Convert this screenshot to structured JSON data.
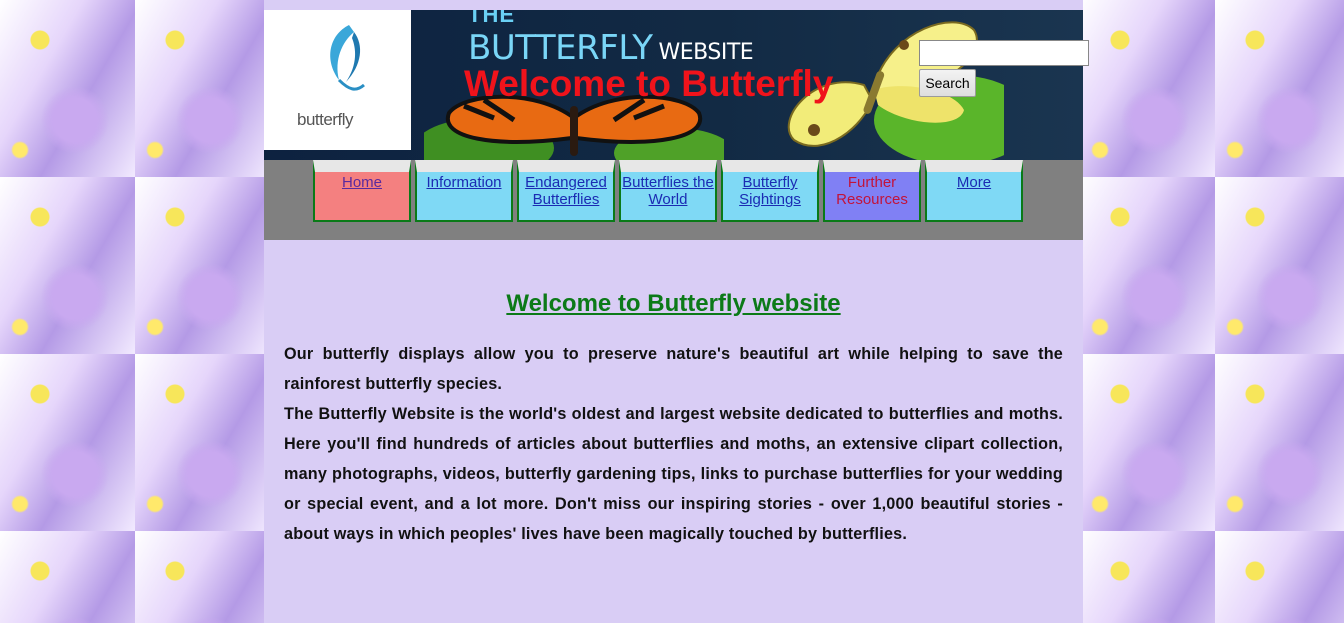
{
  "banner": {
    "logo_text": "butterfly",
    "brand_top": "THE",
    "brand_main": "BUTTERFLY",
    "brand_small": "WEBSITE",
    "welcome": "Welcome to Butterfly"
  },
  "search": {
    "value": "",
    "button_label": "Search"
  },
  "nav": {
    "items": [
      {
        "label": "Home"
      },
      {
        "label": "Information"
      },
      {
        "label": "Endangered Butterflies"
      },
      {
        "label": "Butterflies the World"
      },
      {
        "label": "Butterfly Sightings"
      },
      {
        "label": "Further Resources"
      },
      {
        "label": "More"
      }
    ]
  },
  "content": {
    "title": "Welcome to Butterfly website",
    "paragraph1": "Our butterfly displays allow you to preserve nature's beautiful art while helping to save the rainforest  butterfly species.",
    "paragraph2": "The Butterfly Website is the world's oldest and largest website dedicated to butterflies and moths. Here you'll find hundreds of articles about butterflies and moths, an extensive clipart collection, many photographs, videos, butterfly gardening tips, links to purchase butterflies for your wedding or special event, and a lot more. Don't miss our inspiring stories - over 1,000 beautiful stories - about ways in which peoples' lives have been magically touched by butterflies."
  },
  "colors": {
    "page_bg": "#d9cdf5",
    "nav_bg": "#808080",
    "heading_red": "#f0131b",
    "title_green": "#0c7a18",
    "nav_item_bg": "#7fd9f5",
    "nav_home_bg": "#f48080",
    "nav_further_bg": "#8080f4"
  }
}
